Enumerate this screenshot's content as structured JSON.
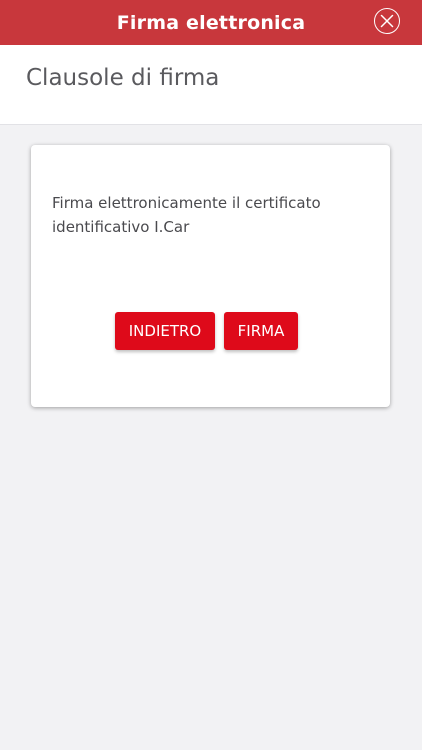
{
  "app": {
    "title": "Firma elettronica",
    "close_icon": "close-circle-icon",
    "brand_color": "#c8373c",
    "button_color": "#de0a1a"
  },
  "header": {
    "title": "Clausole di firma"
  },
  "card": {
    "message": "Firma elettronicamente il certificato identificativo I.Car",
    "back_label": "INDIETRO",
    "sign_label": "FIRMA"
  }
}
